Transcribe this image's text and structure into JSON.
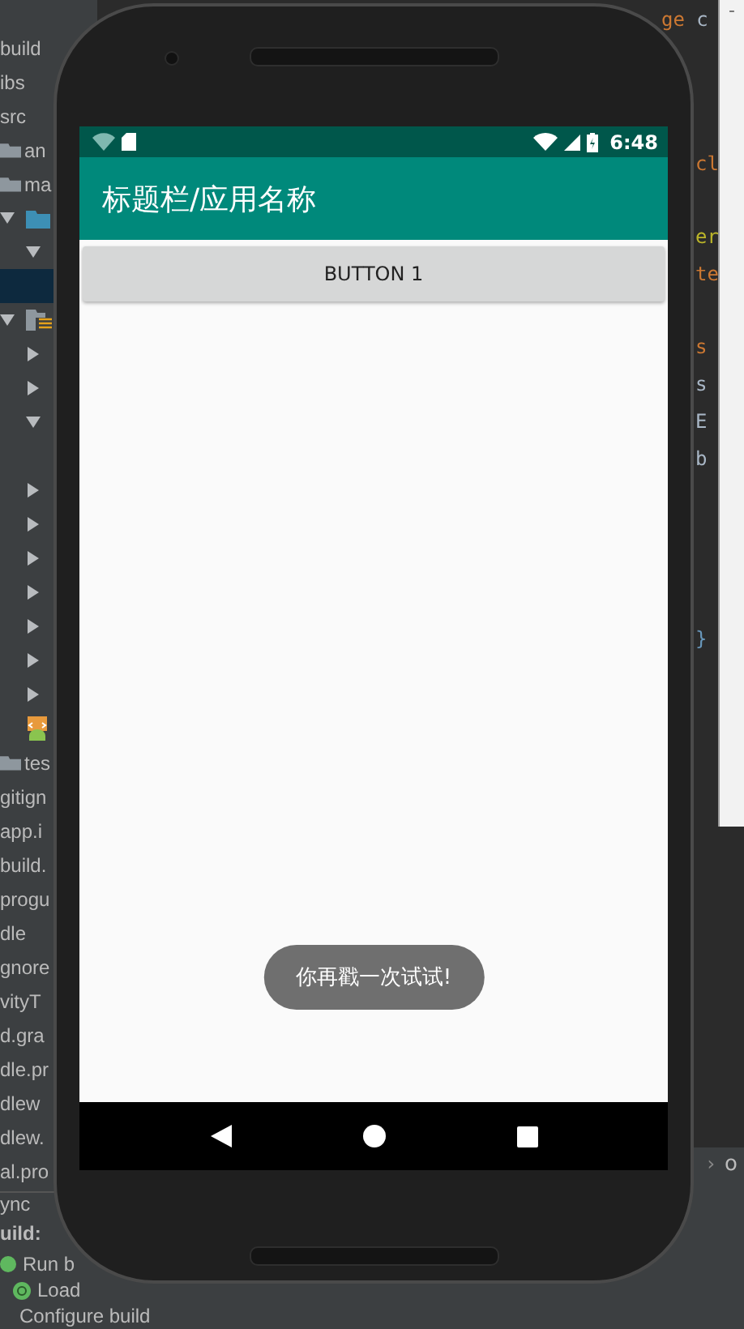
{
  "project_tree": {
    "rows": [
      {
        "kind": "text",
        "text": "build"
      },
      {
        "kind": "text",
        "text": "ibs"
      },
      {
        "kind": "text",
        "text": "src"
      },
      {
        "kind": "folder",
        "text": "an"
      },
      {
        "kind": "folder",
        "text": "ma"
      },
      {
        "kind": "srcbranch",
        "expanded": true
      },
      {
        "kind": "subbranch",
        "expanded": true
      },
      {
        "kind": "highlight"
      },
      {
        "kind": "resbranch",
        "expanded": true
      },
      {
        "kind": "subbranch",
        "expanded": false
      },
      {
        "kind": "subbranch",
        "expanded": false
      },
      {
        "kind": "subbranch",
        "expanded": true
      },
      {
        "kind": "blank"
      },
      {
        "kind": "subbranch",
        "expanded": false
      },
      {
        "kind": "subbranch",
        "expanded": false
      },
      {
        "kind": "subbranch",
        "expanded": false
      },
      {
        "kind": "subbranch",
        "expanded": false
      },
      {
        "kind": "subbranch",
        "expanded": false
      },
      {
        "kind": "subbranch",
        "expanded": false
      },
      {
        "kind": "subbranch",
        "expanded": false
      },
      {
        "kind": "manifest"
      },
      {
        "kind": "folder",
        "text": "tes"
      },
      {
        "kind": "text",
        "text": "gitign"
      },
      {
        "kind": "text",
        "text": "app.i"
      },
      {
        "kind": "text",
        "text": "build."
      },
      {
        "kind": "text",
        "text": "progu"
      },
      {
        "kind": "text",
        "text": "dle"
      },
      {
        "kind": "text",
        "text": "gnore"
      },
      {
        "kind": "text",
        "text": "vityT"
      },
      {
        "kind": "text",
        "text": "d.gra"
      },
      {
        "kind": "text",
        "text": "dle.pr"
      },
      {
        "kind": "text",
        "text": "dlew"
      },
      {
        "kind": "text",
        "text": "dlew."
      },
      {
        "kind": "text",
        "text": "al.pro"
      }
    ]
  },
  "build_panel": {
    "tab": "ync",
    "heading": "uild:",
    "items": [
      {
        "kind": "run",
        "text": "Run b"
      },
      {
        "kind": "ok",
        "text": "Load"
      },
      {
        "kind": "ok",
        "text": "Configure build"
      }
    ]
  },
  "editor": {
    "lines": [
      {
        "kind": "header",
        "parts": [
          {
            "text": "ge",
            "color": "#cc7832"
          },
          {
            "text": " c",
            "color": "#a9b7c6"
          }
        ]
      },
      {
        "kind": "blank"
      },
      {
        "kind": "blank"
      },
      {
        "kind": "blank"
      },
      {
        "kind": "code",
        "parts": [
          {
            "text": "cl",
            "color": "#cc7832"
          }
        ]
      },
      {
        "kind": "blank"
      },
      {
        "kind": "code",
        "parts": [
          {
            "text": "er",
            "color": "#bbb529"
          }
        ]
      },
      {
        "kind": "code",
        "parts": [
          {
            "text": "te",
            "color": "#cc7832"
          }
        ]
      },
      {
        "kind": "blank"
      },
      {
        "kind": "code",
        "parts": [
          {
            "text": "s",
            "color": "#cc7832"
          }
        ]
      },
      {
        "kind": "code",
        "parts": [
          {
            "text": "s",
            "color": "#a9b7c6"
          }
        ]
      },
      {
        "kind": "code",
        "parts": [
          {
            "text": "E",
            "color": "#a9b7c6"
          }
        ]
      },
      {
        "kind": "code",
        "parts": [
          {
            "text": "b",
            "color": "#a9b7c6"
          }
        ]
      },
      {
        "kind": "blank"
      },
      {
        "kind": "blank"
      },
      {
        "kind": "blank"
      },
      {
        "kind": "blank"
      },
      {
        "kind": "code",
        "parts": [
          {
            "text": "}",
            "color": "#6897bb"
          }
        ]
      }
    ],
    "side_panel": {
      "title": "-"
    },
    "breadcrumb": {
      "separator": "›",
      "text": "o"
    }
  },
  "phone": {
    "status_bar": {
      "time": "6:48"
    },
    "app_bar": {
      "title": "标题栏/应用名称"
    },
    "button": {
      "label": "BUTTON 1"
    },
    "toast": {
      "text": "你再戳一次试试!"
    }
  }
}
